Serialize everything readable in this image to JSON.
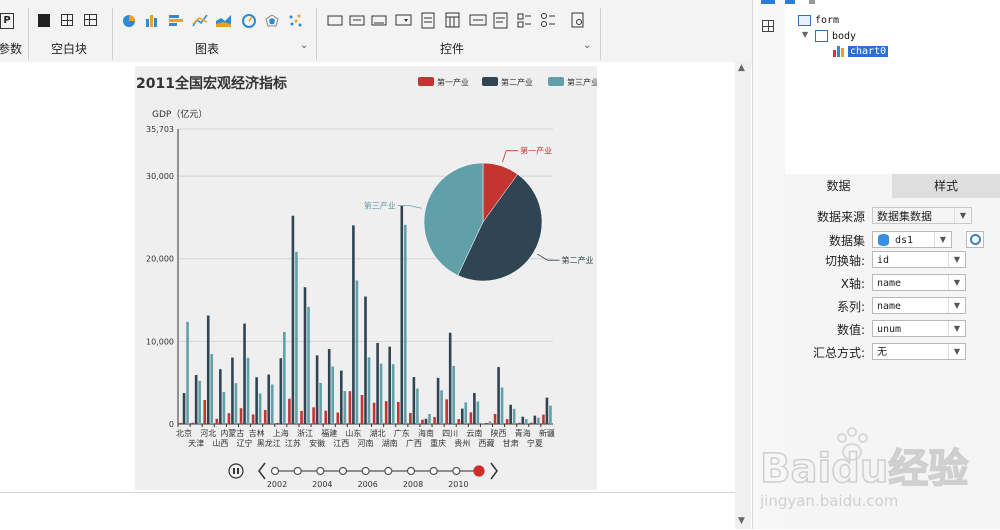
{
  "ribbon": {
    "group_params_label": "参数",
    "group_blank_label": "空白块",
    "group_chart_label": "图表",
    "group_controls_label": "控件",
    "param_icon_text": "P"
  },
  "right_panel": {
    "tree": {
      "form": "form",
      "body": "body",
      "chart": "chart0"
    },
    "tabs": {
      "data": "数据",
      "style": "样式"
    },
    "props": [
      {
        "label": "数据来源",
        "value": "数据集数据"
      },
      {
        "label": "数据集",
        "value": "ds1"
      },
      {
        "label": "切换轴:",
        "value": "id"
      },
      {
        "label": "X轴:",
        "value": "name"
      },
      {
        "label": "系列:",
        "value": "name"
      },
      {
        "label": "数值:",
        "value": "unum"
      },
      {
        "label": "汇总方式:",
        "value": "无"
      }
    ]
  },
  "watermark": {
    "brand": "Baidu经验",
    "url": "jingyan.baidu.com"
  },
  "chart_data": {
    "type": "bar",
    "title": "2011全国宏观经济指标",
    "ylabel": "GDP（亿元）",
    "ylim": [
      0,
      35703
    ],
    "yticks": [
      0,
      10000,
      20000,
      30000,
      35703
    ],
    "ytick_labels": [
      "0",
      "10,000",
      "20,000",
      "30,000",
      "35,703"
    ],
    "legend_position": "top-right",
    "categories": [
      "北京",
      "天津",
      "河北",
      "山西",
      "内蒙古",
      "辽宁",
      "吉林",
      "黑龙江",
      "上海",
      "江苏",
      "浙江",
      "安徽",
      "福建",
      "江西",
      "山东",
      "河南",
      "湖北",
      "湖南",
      "广东",
      "广西",
      "海南",
      "重庆",
      "四川",
      "贵州",
      "云南",
      "西藏",
      "陕西",
      "甘肃",
      "青海",
      "宁夏",
      "新疆"
    ],
    "series": [
      {
        "name": "第一产业",
        "color": "#c23531",
        "values": [
          136,
          160,
          2905,
          641,
          1307,
          1916,
          1155,
          1701,
          124,
          3065,
          1583,
          2015,
          1612,
          1391,
          3973,
          3512,
          2570,
          2768,
          2665,
          1326,
          526,
          845,
          2983,
          594,
          1411,
          66,
          1220,
          593,
          156,
          160,
          1139
        ]
      },
      {
        "name": "第二产业",
        "color": "#2f4554",
        "values": [
          3752,
          5928,
          13127,
          6635,
          8038,
          12152,
          5653,
          5988,
          7959,
          25204,
          16555,
          8309,
          9070,
          6462,
          24036,
          15428,
          9815,
          9361,
          26447,
          5682,
          628,
          5582,
          11041,
          1860,
          3746,
          106,
          6890,
          2325,
          883,
          1013,
          3190
        ]
      },
      {
        "name": "第三产业",
        "color": "#61a0a8",
        "values": [
          12364,
          5219,
          8466,
          3876,
          4946,
          8024,
          3704,
          4787,
          11142,
          20842,
          14180,
          4976,
          6957,
          3989,
          17370,
          8068,
          7295,
          7240,
          24097,
          4285,
          1206,
          4078,
          7036,
          2622,
          2722,
          310,
          4412,
          1827,
          586,
          766,
          2217
        ]
      }
    ],
    "pie": {
      "slices": [
        {
          "name": "第一产业",
          "share": 0.1
        },
        {
          "name": "第二产业",
          "share": 0.47
        },
        {
          "name": "第三产业",
          "share": 0.43
        }
      ]
    },
    "timeline": {
      "labels": [
        "2002",
        "2004",
        "2006",
        "2008",
        "2010"
      ],
      "current": "2011"
    }
  }
}
